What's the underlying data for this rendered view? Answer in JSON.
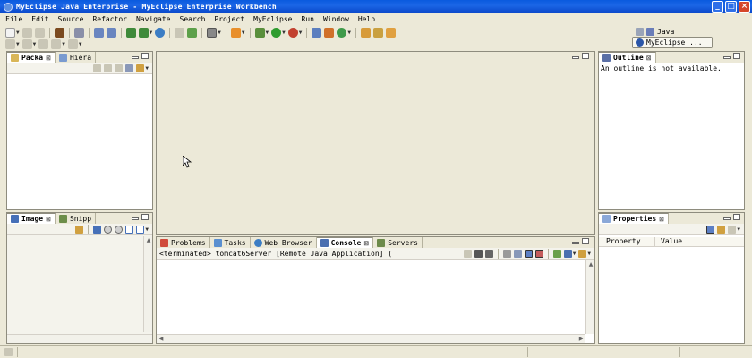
{
  "window": {
    "title": "MyEclipse Java Enterprise - MyEclipse Enterprise Workbench"
  },
  "menu": {
    "items": [
      "File",
      "Edit",
      "Source",
      "Refactor",
      "Navigate",
      "Search",
      "Project",
      "MyEclipse",
      "Run",
      "Window",
      "Help"
    ]
  },
  "perspectives": {
    "java_label": "Java",
    "active_label": "MyEclipse ..."
  },
  "left_top_panel": {
    "tabs": [
      "Packa",
      "Hiera"
    ]
  },
  "left_bottom_panel": {
    "tabs": [
      "Image",
      "Snipp"
    ]
  },
  "outline_panel": {
    "tab": "Outline",
    "message": "An outline is not available."
  },
  "properties_panel": {
    "tab": "Properties",
    "columns": [
      "Property",
      "Value"
    ]
  },
  "bottom_panel": {
    "tabs": [
      "Problems",
      "Tasks",
      "Web Browser",
      "Console",
      "Servers"
    ],
    "active_tab": "Console",
    "console_header": "<terminated> tomcat6Server [Remote Java Application] ("
  },
  "colors": {
    "titlebar": "#0a5ade",
    "chrome": "#ece9d8",
    "border": "#8e8c7e"
  }
}
